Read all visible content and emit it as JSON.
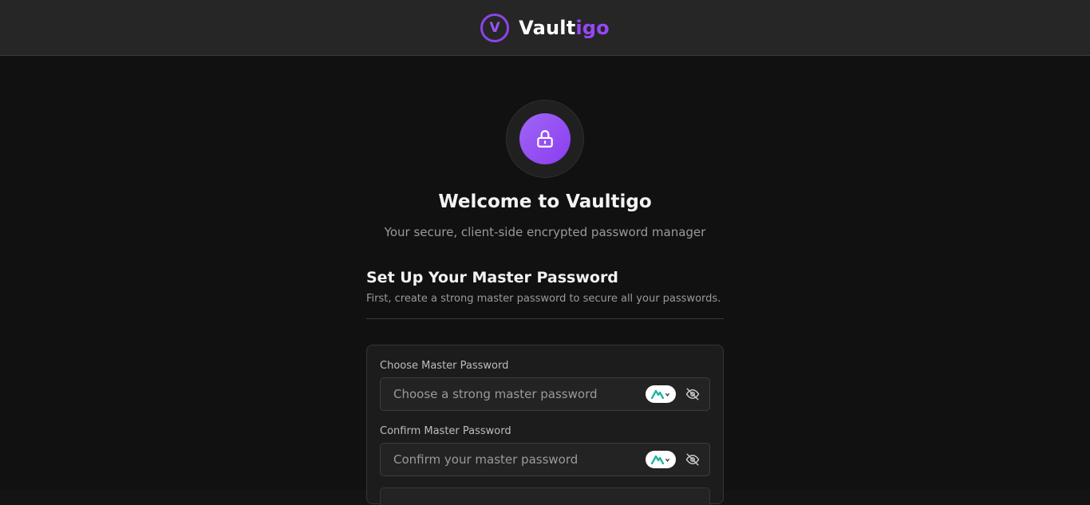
{
  "header": {
    "logo_letter": "V",
    "brand_main": "Vault",
    "brand_accent": "igo",
    "accent_color": "#9747f5"
  },
  "hero": {
    "icon": "lock-icon",
    "title": "Welcome to Vaultigo",
    "subtitle": "Your secure, client-side encrypted password manager"
  },
  "setup": {
    "title": "Set Up Your Master Password",
    "description": "First, create a strong master password to secure all your passwords."
  },
  "form": {
    "master": {
      "label": "Choose Master Password",
      "placeholder": "Choose a strong master password",
      "value": ""
    },
    "confirm": {
      "label": "Confirm Master Password",
      "placeholder": "Confirm your master password",
      "value": ""
    },
    "icons": {
      "extension": "password-manager-extension-icon",
      "visibility": "eye-off-icon"
    }
  }
}
